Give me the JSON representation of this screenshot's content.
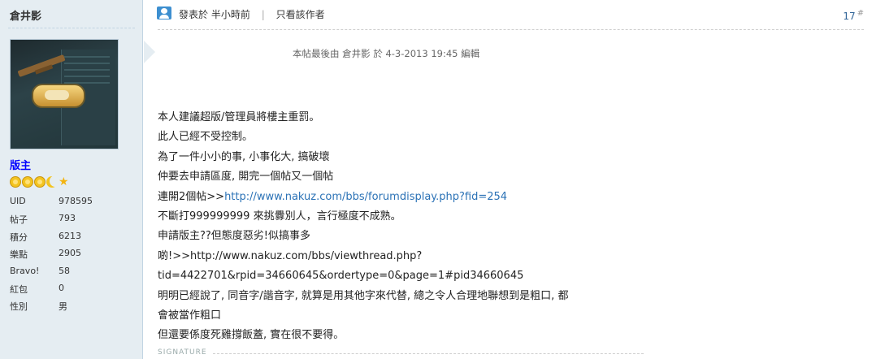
{
  "user": {
    "name": "倉井影",
    "rank": "版主",
    "stats": [
      {
        "label": "UID",
        "value": "978595"
      },
      {
        "label": "帖子",
        "value": "793"
      },
      {
        "label": "積分",
        "value": "6213"
      },
      {
        "label": "樂點",
        "value": "2905"
      },
      {
        "label": "Bravo!",
        "value": "58"
      },
      {
        "label": "紅包",
        "value": "0"
      },
      {
        "label": "性別",
        "value": "男"
      }
    ],
    "medals": [
      "sun-medal-icon",
      "sun-medal-icon",
      "sun-medal-icon",
      "moon-medal-icon",
      "star-medal-icon"
    ]
  },
  "post": {
    "posted_label": "發表於",
    "posted_time": "半小時前",
    "separator": "|",
    "only_author": "只看該作者",
    "floor": "17",
    "floor_mark": "#",
    "edit_note": "本帖最後由 倉井影 於 4-3-2013 19:45 編輯",
    "lines": [
      {
        "text": "本人建議超版/管理員將樓主重罰。"
      },
      {
        "text": "此人已經不受控制。"
      },
      {
        "text": "為了一件小小的事, 小事化大, 搞破壞"
      },
      {
        "text": "仲要去申請區度, 開完一個帖又一個帖"
      },
      {
        "text": "連開2個帖>>",
        "link": "http://www.nakuz.com/bbs/forumdisplay.php?fid=254"
      },
      {
        "text": "不斷打999999999 來挑釁別人，言行極度不成熟。"
      },
      {
        "text": "申請版主??但態度惡劣!似搞事多"
      },
      {
        "text": "啲!>>http://www.nakuz.com/bbs/viewthread.php?"
      },
      {
        "text": "tid=4422701&rpid=34660645&ordertype=0&page=1#pid34660645"
      },
      {
        "text": "明明已經說了, 同音字/諧音字, 就算是用其他字來代替, 總之令人合理地聯想到是粗口, 都"
      },
      {
        "text": "會被當作粗口"
      },
      {
        "text": "但還要係度死雞撐飯蓋, 實在很不要得。"
      }
    ],
    "signature_label": "SIGNATURE"
  }
}
